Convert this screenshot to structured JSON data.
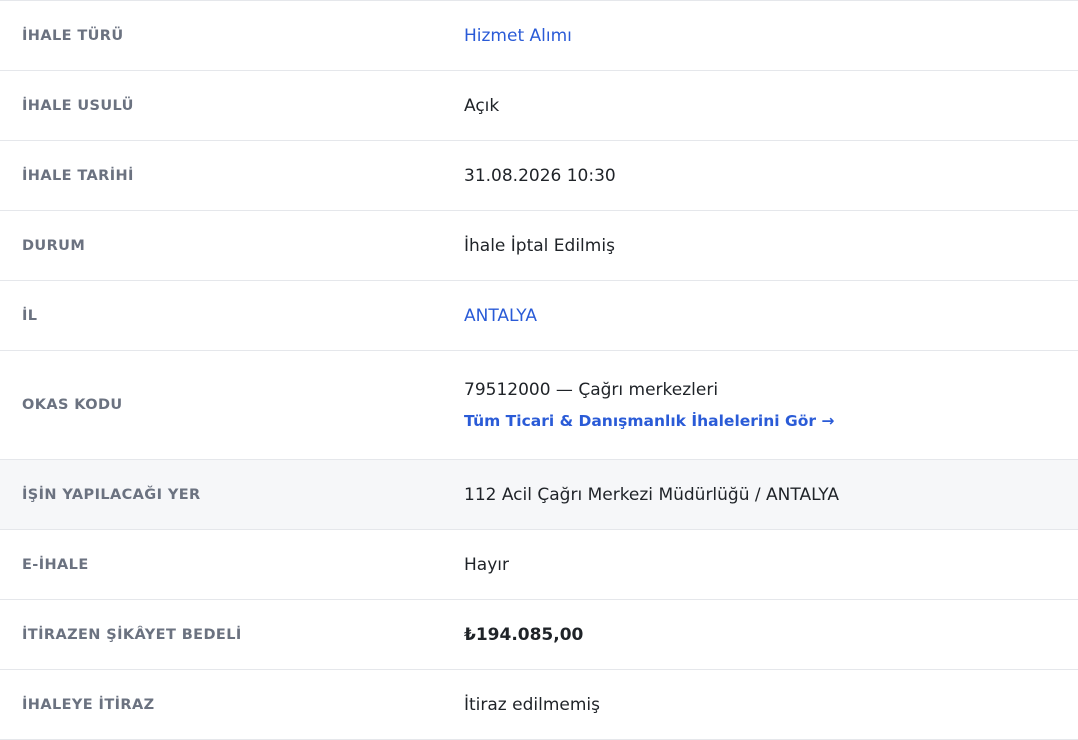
{
  "details": {
    "tender_type": {
      "label": "İHALE TÜRÜ",
      "value": "Hizmet Alımı"
    },
    "procedure": {
      "label": "İHALE USULÜ",
      "value": "Açık"
    },
    "date": {
      "label": "İHALE TARİHİ",
      "value": "31.08.2026 10:30"
    },
    "status": {
      "label": "DURUM",
      "value": "İhale İptal Edilmiş"
    },
    "province": {
      "label": "İL",
      "value": "ANTALYA"
    },
    "okas": {
      "label": "OKAS KODU",
      "value": "79512000 — Çağrı merkezleri",
      "link": "Tüm Ticari & Danışmanlık İhalelerini Gör →"
    },
    "location": {
      "label": "İŞİN YAPILACAĞI YER",
      "value": "112 Acil Çağrı Merkezi Müdürlüğü / ANTALYA"
    },
    "e_tender": {
      "label": "E-İHALE",
      "value": "Hayır"
    },
    "complaint_fee": {
      "label": "İTİRAZEN ŞİKÂYET BEDELİ",
      "value": "₺194.085,00"
    },
    "objection": {
      "label": "İHALEYE İTİRAZ",
      "value": "İtiraz edilmemiş"
    }
  },
  "colors": {
    "link": "#2a5bd7",
    "label": "#6b7280",
    "text": "#1f2328",
    "border": "#e5e7eb",
    "highlight_row": "#f6f7f9"
  }
}
